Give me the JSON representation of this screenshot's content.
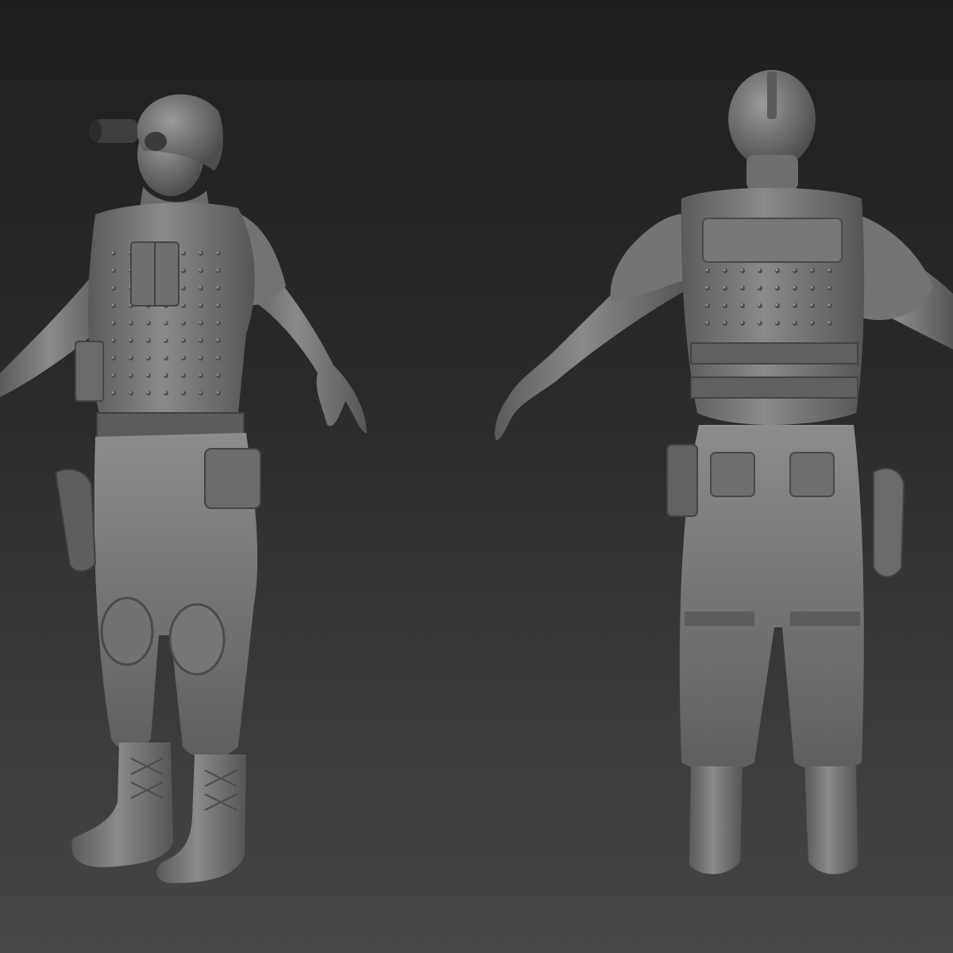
{
  "scene": {
    "background_top": "#1f1f1f",
    "background_bottom": "#464646",
    "clay_color": "#7a7a7a",
    "clay_dark": "#4a4a4a",
    "clay_light": "#a8a8a8"
  },
  "views": [
    {
      "id": "front-three-quarter",
      "icon": "sculpt-figure-front"
    },
    {
      "id": "back",
      "icon": "sculpt-figure-back"
    }
  ]
}
